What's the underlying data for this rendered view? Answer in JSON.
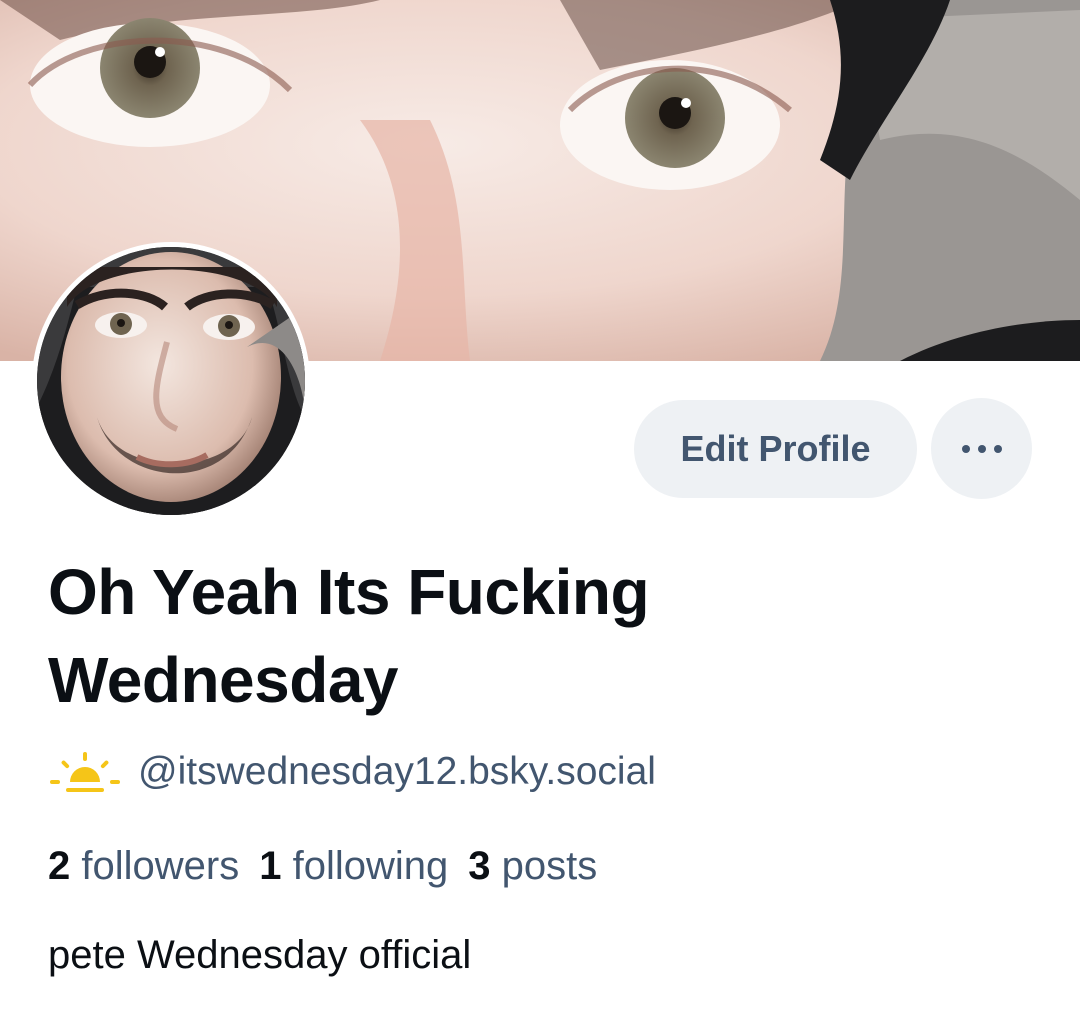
{
  "profile": {
    "display_name": "Oh Yeah Its Fucking Wednesday",
    "handle": "@itswednesday12.bsky.social",
    "bio": "pete Wednesday official",
    "stats": [
      {
        "count": "2",
        "label": "followers"
      },
      {
        "count": "1",
        "label": "following"
      },
      {
        "count": "3",
        "label": "posts"
      }
    ]
  },
  "actions": {
    "edit_label": "Edit Profile",
    "more_icon": "ellipsis-icon"
  },
  "icons": {
    "handle_icon": "sunrise-icon"
  },
  "colors": {
    "button_bg": "#eef1f4",
    "button_text": "#42566f",
    "secondary_text": "#42566f",
    "primary_text": "#0b0f14",
    "sun_yellow": "#f5c518"
  }
}
